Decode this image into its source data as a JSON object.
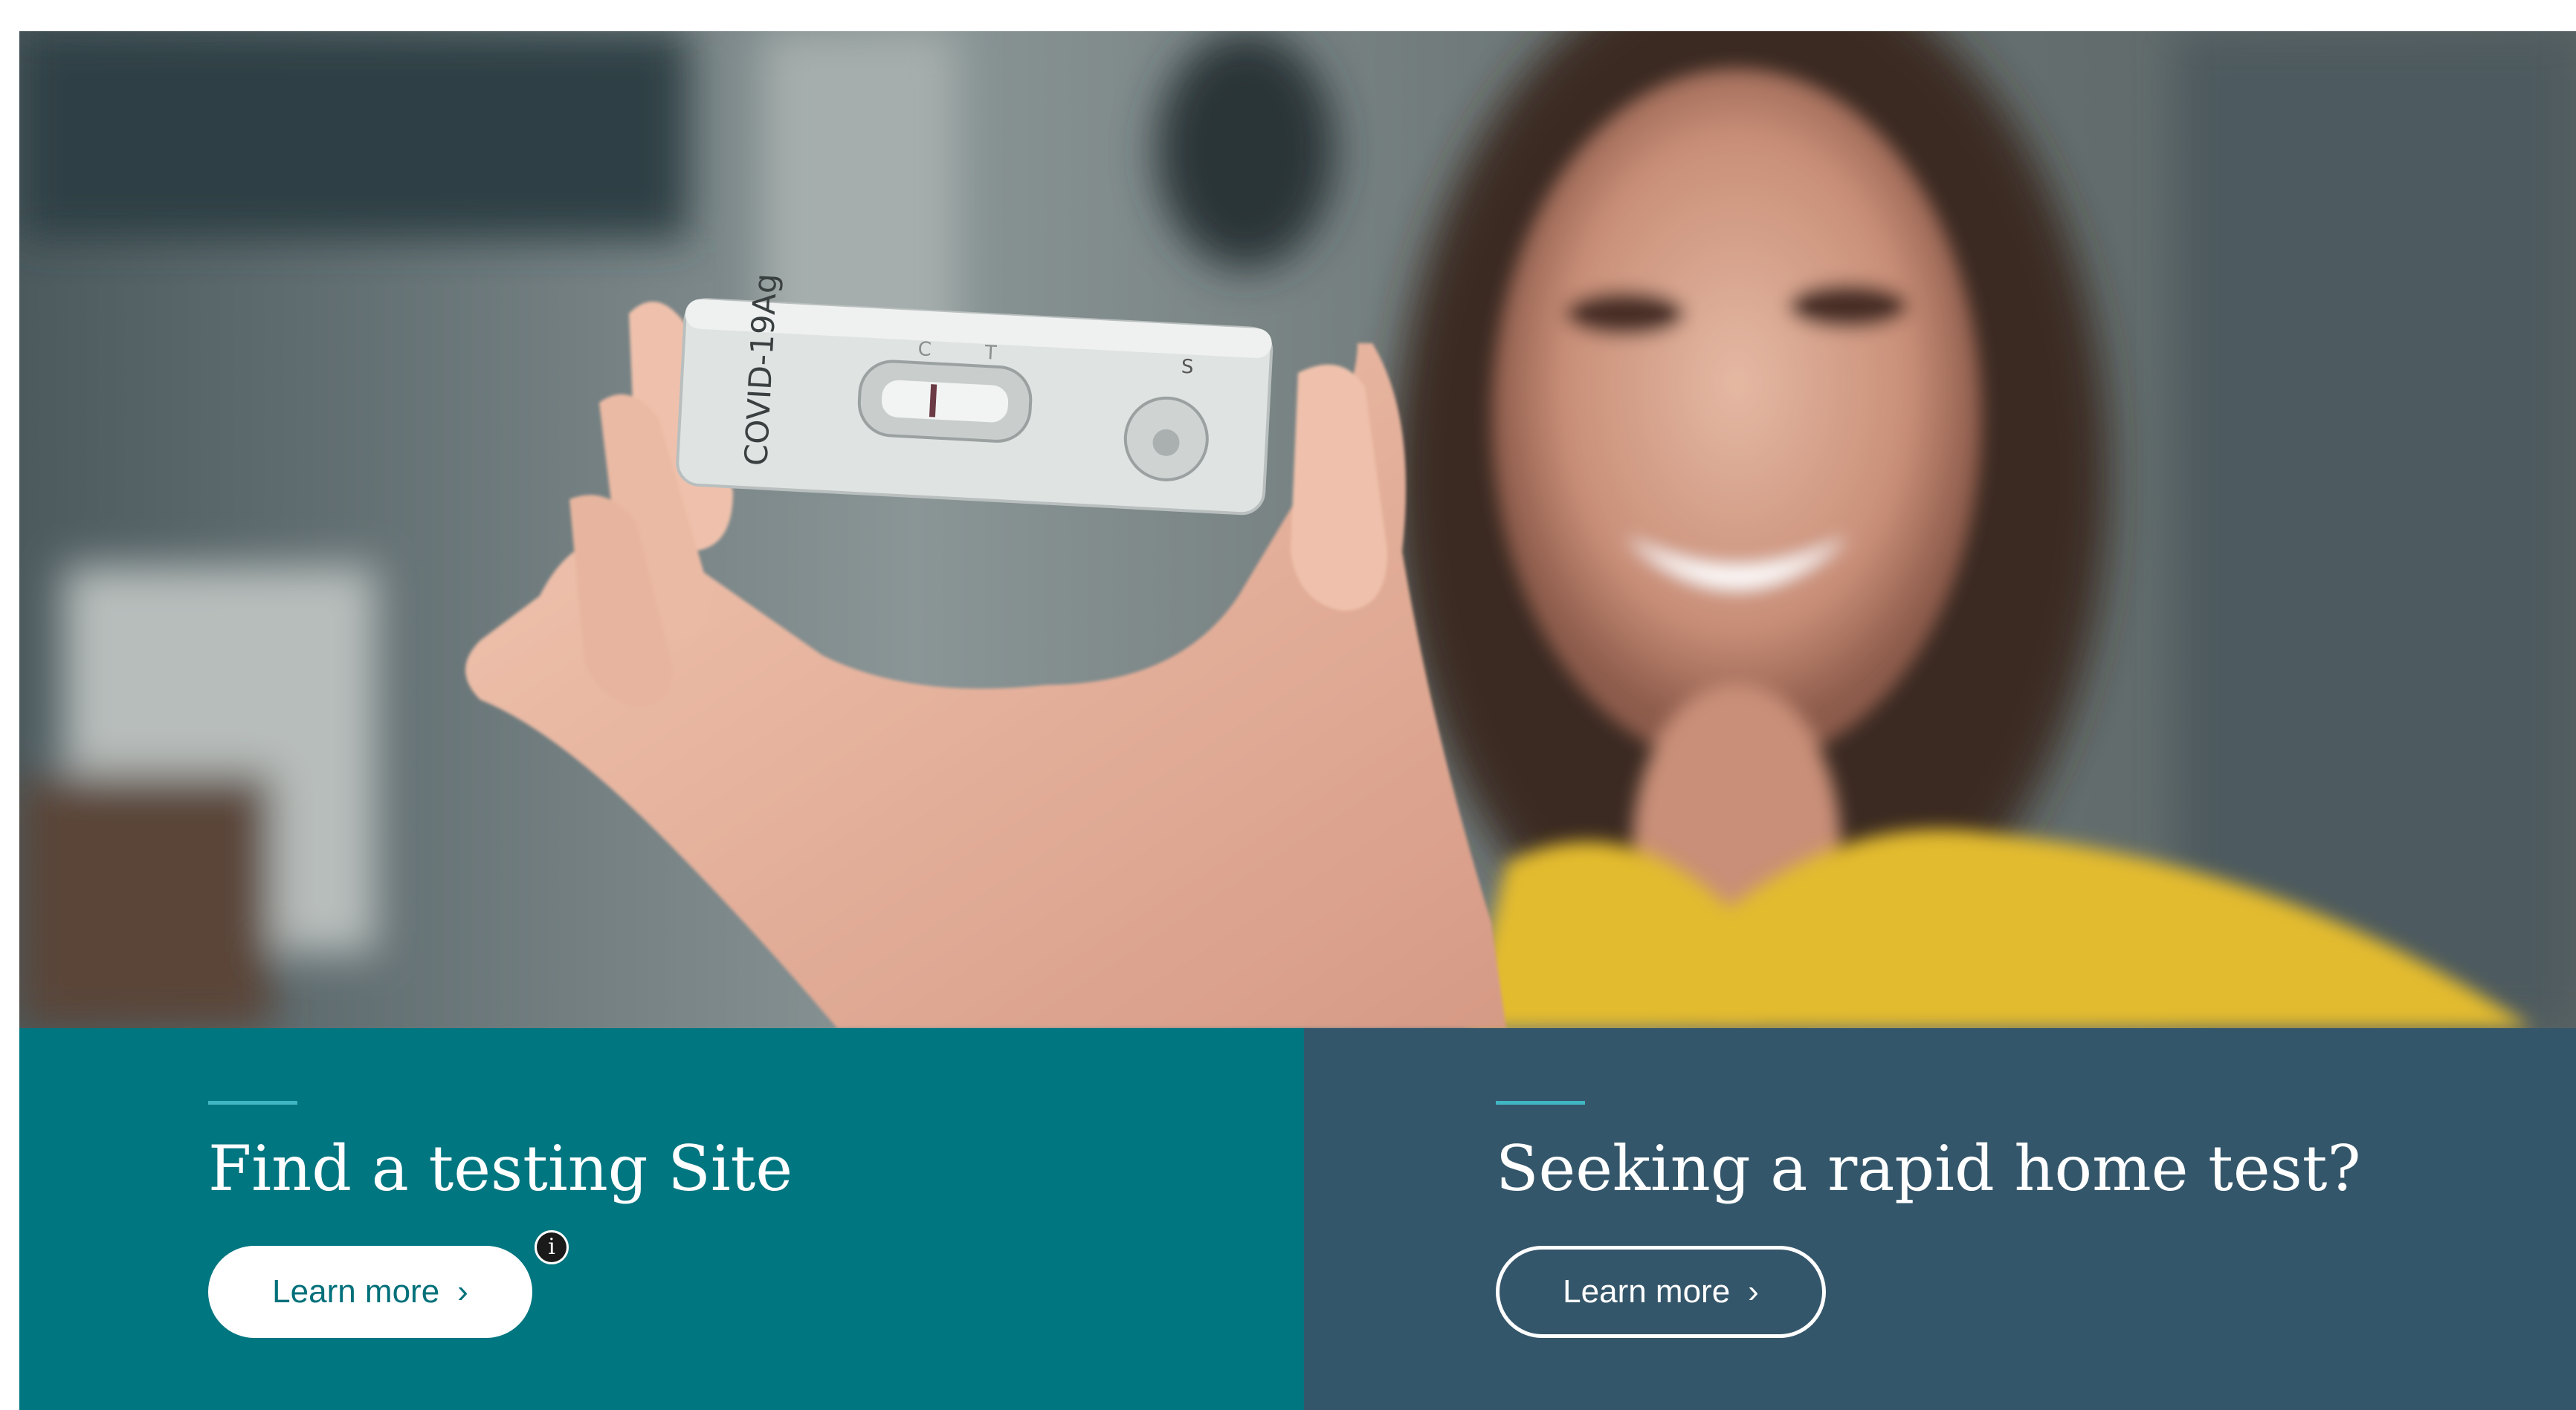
{
  "hero": {
    "image_alt": "Smiling woman holding a COVID-19 rapid antigen test cassette",
    "cassette_label": "COVID-19Ag",
    "cassette_marks": [
      "C",
      "T"
    ],
    "cassette_sample_mark": "S",
    "background_color": "#5d6a6c"
  },
  "panels": [
    {
      "title": "Find a testing Site",
      "button_label": "Learn more",
      "button_chevron": "›",
      "info_badge": "i",
      "background_color": "#007680",
      "accent_color": "#41b6c3"
    },
    {
      "title": "Seeking a rapid home test?",
      "button_label": "Learn more",
      "button_chevron": "›",
      "background_color": "#34566a",
      "accent_color": "#41b6c3"
    }
  ]
}
